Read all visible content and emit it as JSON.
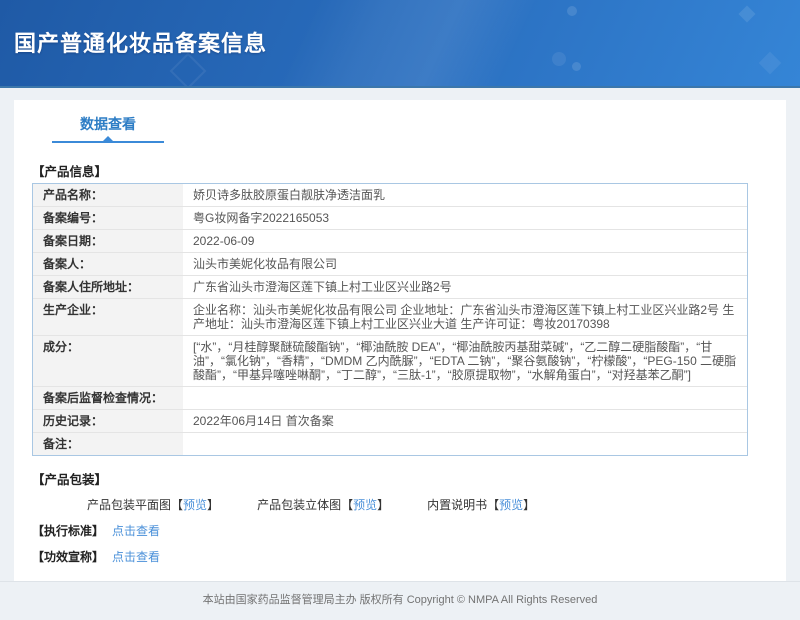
{
  "header": {
    "title": "国产普通化妆品备案信息"
  },
  "tab": {
    "label": "数据查看"
  },
  "product_info": {
    "section_title": "【产品信息】",
    "rows": [
      {
        "label": "产品名称：",
        "value": "娇贝诗多肽胶原蛋白靓肤净透洁面乳"
      },
      {
        "label": "备案编号：",
        "value": "粤G妆网备字2022165053"
      },
      {
        "label": "备案日期：",
        "value": "2022-06-09"
      },
      {
        "label": "备案人：",
        "value": "汕头市美妮化妆品有限公司"
      },
      {
        "label": "备案人住所地址：",
        "value": "广东省汕头市澄海区莲下镇上村工业区兴业路2号"
      },
      {
        "label": "生产企业：",
        "value": "企业名称：汕头市美妮化妆品有限公司 企业地址：广东省汕头市澄海区莲下镇上村工业区兴业路2号 生产地址：汕头市澄海区莲下镇上村工业区兴业大道 生产许可证：粤妆20170398"
      },
      {
        "label": "成分：",
        "value": "[“水”，“月桂醇聚醚硫酸酯钠”，“椰油酰胺 DEA”，“椰油酰胺丙基甜菜碱”，“乙二醇二硬脂酸酯”，“甘油”，“氯化钠”，“香精”，“DMDM 乙内酰脲”，“EDTA 二钠”，“聚谷氨酸钠”，“柠檬酸”，“PEG-150 二硬脂酸酯”，“甲基异噻唑啉酮”，“丁二醇”，“三肽-1”，“胶原提取物”，“水解角蛋白”，“对羟基苯乙酮”]"
      },
      {
        "label": "备案后监督检查情况：",
        "value": ""
      },
      {
        "label": "历史记录：",
        "value": "2022年06月14日 首次备案"
      },
      {
        "label": "备注：",
        "value": ""
      }
    ]
  },
  "packaging": {
    "section_title": "【产品包装】",
    "bracket_open": "【",
    "bracket_close": "】",
    "items": [
      {
        "label": "产品包装平面图",
        "link": "预览"
      },
      {
        "label": "产品包装立体图",
        "link": "预览"
      },
      {
        "label": "内置说明书",
        "link": "预览"
      }
    ]
  },
  "extra_sections": [
    {
      "label": "【执行标准】",
      "link": "点击查看"
    },
    {
      "label": "【功效宣称】",
      "link": "点击查看"
    }
  ],
  "footer": {
    "text": "本站由国家药品监督管理局主办 版权所有 Copyright © NMPA All Rights Reserved"
  },
  "colors": {
    "accent_blue": "#2d7dc5",
    "link_blue": "#4a90d9",
    "header_top": "#1f5aa6",
    "header_bottom": "#3585d6"
  }
}
